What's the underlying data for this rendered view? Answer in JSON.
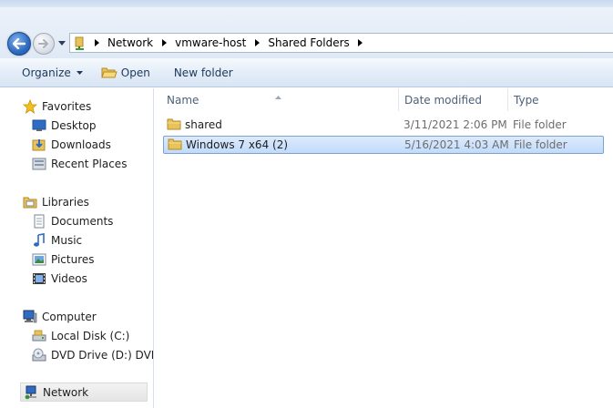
{
  "address": {
    "crumbs": [
      "Network",
      "vmware-host",
      "Shared Folders"
    ]
  },
  "toolbar": {
    "organize_label": "Organize",
    "open_label": "Open",
    "new_folder_label": "New folder"
  },
  "nav": {
    "favorites": "Favorites",
    "desktop": "Desktop",
    "downloads": "Downloads",
    "recent_places": "Recent Places",
    "libraries": "Libraries",
    "documents": "Documents",
    "music": "Music",
    "pictures": "Pictures",
    "videos": "Videos",
    "computer": "Computer",
    "local_disk": "Local Disk (C:)",
    "dvd_drive": "DVD Drive (D:) DVD_",
    "network": "Network"
  },
  "columns": {
    "name": "Name",
    "date_modified": "Date modified",
    "type": "Type"
  },
  "files": [
    {
      "name": "shared",
      "date": "3/11/2021 2:06 PM",
      "type": "File folder"
    },
    {
      "name": "Windows 7 x64 (2)",
      "date": "5/16/2021 4:03 AM",
      "type": "File folder"
    }
  ],
  "colors": {
    "accent": "#2f6bc2",
    "selection": "#c1dbfc",
    "folder": "#e8c25a"
  }
}
